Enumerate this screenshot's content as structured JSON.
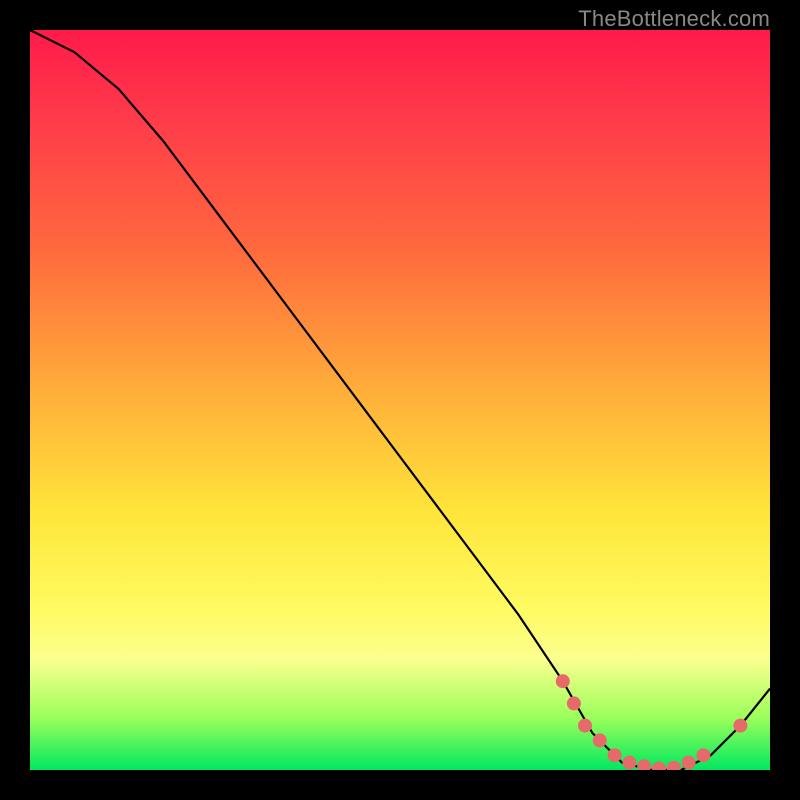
{
  "watermark": "TheBottleneck.com",
  "chart_data": {
    "type": "line",
    "title": "",
    "xlabel": "",
    "ylabel": "",
    "xlim": [
      0,
      100
    ],
    "ylim": [
      0,
      100
    ],
    "series": [
      {
        "name": "bottleneck-curve",
        "x": [
          0,
          6,
          12,
          18,
          24,
          30,
          36,
          42,
          48,
          54,
          60,
          66,
          72,
          76,
          80,
          84,
          88,
          92,
          96,
          100
        ],
        "y": [
          100,
          97,
          92,
          85,
          77,
          69,
          61,
          53,
          45,
          37,
          29,
          21,
          12,
          5,
          1,
          0,
          0,
          2,
          6,
          11
        ]
      }
    ],
    "markers": [
      {
        "name": "highlight-dot",
        "x": 72,
        "y": 12
      },
      {
        "name": "highlight-dot",
        "x": 73.5,
        "y": 9
      },
      {
        "name": "highlight-dot",
        "x": 75,
        "y": 6
      },
      {
        "name": "highlight-dot",
        "x": 77,
        "y": 4
      },
      {
        "name": "highlight-dot",
        "x": 79,
        "y": 2
      },
      {
        "name": "highlight-dot",
        "x": 81,
        "y": 1
      },
      {
        "name": "highlight-dot",
        "x": 83,
        "y": 0.5
      },
      {
        "name": "highlight-dot",
        "x": 85,
        "y": 0.2
      },
      {
        "name": "highlight-dot",
        "x": 87,
        "y": 0.3
      },
      {
        "name": "highlight-dot",
        "x": 89,
        "y": 1
      },
      {
        "name": "highlight-dot",
        "x": 91,
        "y": 2
      },
      {
        "name": "highlight-dot",
        "x": 96,
        "y": 6
      }
    ],
    "colors": {
      "curve": "#000000",
      "marker": "#e76a6a",
      "gradient_top": "#ff1a4a",
      "gradient_mid": "#ffe43a",
      "gradient_bottom": "#00e860"
    }
  }
}
